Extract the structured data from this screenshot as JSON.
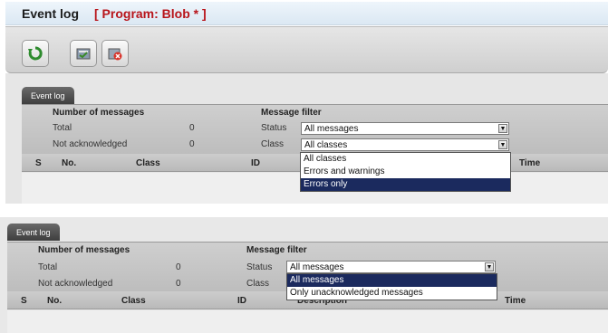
{
  "title": {
    "main": "Event log",
    "program": "[ Program: Blob * ]"
  },
  "toolbar": {
    "icons": [
      "refresh-icon",
      "acknowledge-icon",
      "delete-icon"
    ]
  },
  "panel_top": {
    "tab": "Event log",
    "number_of_messages": "Number of messages",
    "total_label": "Total",
    "total_value": "0",
    "not_ack_label": "Not acknowledged",
    "not_ack_value": "0",
    "message_filter": "Message filter",
    "status_label": "Status",
    "status_value": "All messages",
    "class_label": "Class",
    "class_value": "All classes",
    "class_options": [
      "All classes",
      "Errors and warnings",
      "Errors only"
    ],
    "class_selected_index": 2,
    "columns": {
      "s": "S",
      "no": "No.",
      "class": "Class",
      "id": "ID",
      "time": "Time"
    }
  },
  "panel_bottom": {
    "tab": "Event log",
    "number_of_messages": "Number of messages",
    "total_label": "Total",
    "total_value": "0",
    "not_ack_label": "Not acknowledged",
    "not_ack_value": "0",
    "message_filter": "Message filter",
    "status_label": "Status",
    "status_value": "All messages",
    "class_label": "Class",
    "status_options": [
      "All messages",
      "Only unacknowledged messages"
    ],
    "status_selected_index": 0,
    "columns": {
      "s": "S",
      "no": "No.",
      "class": "Class",
      "id": "ID",
      "description": "Description",
      "time": "Time"
    }
  },
  "colors": {
    "selection": "#1b2a5e",
    "program_title": "#b8151b",
    "tab": "#4a4a4a"
  }
}
